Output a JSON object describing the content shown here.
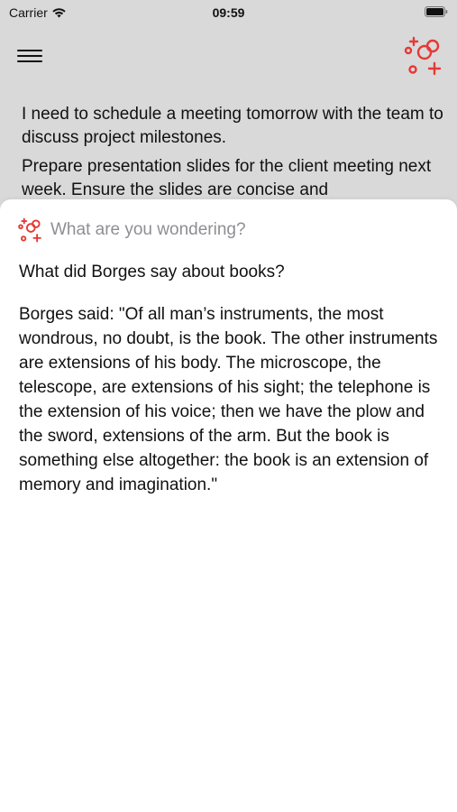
{
  "status_bar": {
    "carrier": "Carrier",
    "time": "09:59"
  },
  "header": {
    "menu_icon": "hamburger-menu-icon",
    "logo_icon": "sparkle-circles-icon"
  },
  "notes": [
    "I need to schedule a meeting tomorrow with the team to discuss project milestones.",
    "Prepare presentation slides for the client meeting next week. Ensure the slides are concise and"
  ],
  "ask_sheet": {
    "search": {
      "placeholder": "What are you wondering?",
      "value": ""
    },
    "question": "What did Borges say about books?",
    "answer": "Borges said: \"Of all man’s instruments, the most wondrous, no doubt, is the book. The other instruments are extensions of his body. The microscope, the telescope, are extensions of his sight; the telephone is the extension of his voice; then we have the plow and the sword, extensions of the arm. But the book is something else altogether: the book is an extension of memory and imagination.\""
  },
  "colors": {
    "accent": "#e53935",
    "background_dimmed": "#d9d9d9",
    "sheet": "#ffffff",
    "placeholder": "#8e8e93"
  }
}
